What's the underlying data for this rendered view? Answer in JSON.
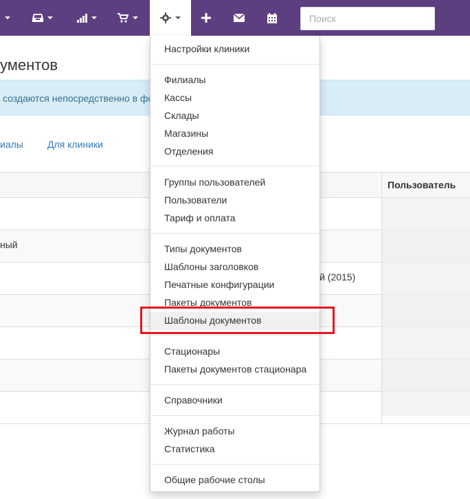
{
  "navbar": {
    "background": "#5c3f80",
    "items": [
      {
        "icon": "caret-down-icon"
      },
      {
        "icon": "inbox-icon"
      },
      {
        "icon": "bar-chart-icon"
      },
      {
        "icon": "shopping-cart-icon"
      },
      {
        "icon": "gear-icon"
      },
      {
        "icon": "plus-icon"
      },
      {
        "icon": "envelope-icon"
      },
      {
        "icon": "calendar-icon"
      }
    ],
    "search_placeholder": "Поиск"
  },
  "page": {
    "title": "ументов",
    "alert_text": "создаются непосредственно в фо",
    "tabs": [
      "иалы",
      "Для клиники"
    ]
  },
  "table": {
    "user_header": "Пользователь",
    "rows": [
      {
        "left": "",
        "right": ""
      },
      {
        "left": "ный",
        "right": ""
      },
      {
        "left": "",
        "right": "ый (2015)"
      },
      {
        "left": "",
        "right": ""
      },
      {
        "left": "",
        "right": ""
      },
      {
        "left": "",
        "right": ""
      },
      {
        "left": "",
        "right": ""
      }
    ]
  },
  "dropdown": {
    "groups": [
      [
        "Настройки клиники"
      ],
      [
        "Филиалы",
        "Кассы",
        "Склады",
        "Магазины",
        "Отделения"
      ],
      [
        "Группы пользователей",
        "Пользователи",
        "Тариф и оплата"
      ],
      [
        "Типы документов",
        "Шаблоны заголовков",
        "Печатные конфигурации",
        "Пакеты документов",
        "Шаблоны документов"
      ],
      [
        "Стационары",
        "Пакеты документов стационара"
      ],
      [
        "Справочники"
      ],
      [
        "Журнал работы",
        "Статистика"
      ],
      [
        "Общие рабочие столы"
      ]
    ],
    "highlighted": "Шаблоны документов"
  },
  "highlight_color": "#e8141c"
}
